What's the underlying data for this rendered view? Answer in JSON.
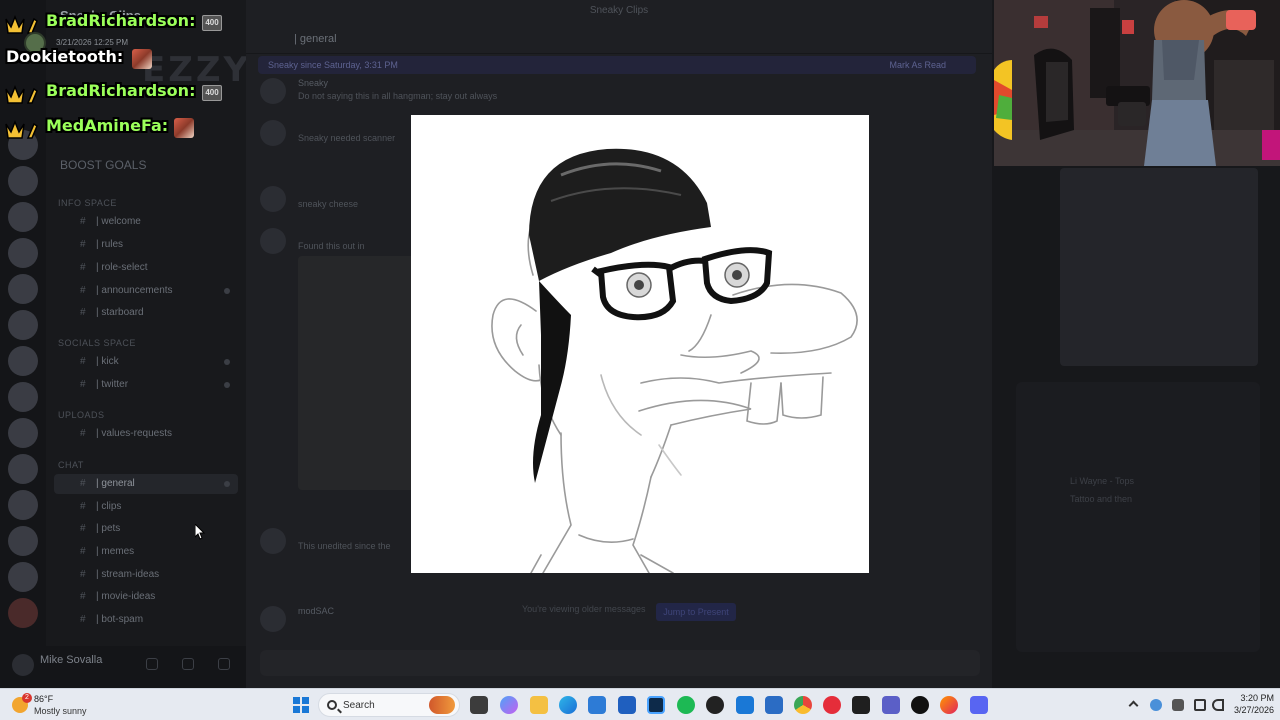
{
  "discord": {
    "window_title": "Sneaky Clips",
    "server_name": "Sneaky Clips",
    "banner_text": "EZZY",
    "channel_title": "| general",
    "boost_line": "BOOST GOALS",
    "categories": [
      {
        "label": "Info space"
      },
      {
        "label": "Socials space"
      },
      {
        "label": "Uploads"
      },
      {
        "label": "Chat"
      }
    ],
    "channels": [
      {
        "label": "| welcome"
      },
      {
        "label": "| rules"
      },
      {
        "label": "| role-select"
      },
      {
        "label": "| announcements"
      },
      {
        "label": "| starboard"
      },
      {
        "label": "| kick"
      },
      {
        "label": "| twitter"
      },
      {
        "label": "| values-requests"
      },
      {
        "label": "| general"
      },
      {
        "label": "| clips"
      },
      {
        "label": "| pets"
      },
      {
        "label": "| memes"
      },
      {
        "label": "| stream-ideas"
      },
      {
        "label": "| movie-ideas"
      },
      {
        "label": "| bot-spam"
      }
    ],
    "user_name": "Mike Sovalla",
    "pinned_text": "Sneaky since Saturday, 3:31 PM",
    "pinned_action": "Mark As Read",
    "messages": [
      {
        "name": "Sneaky",
        "text": "Do not saying this in all hangman; stay out always"
      },
      {
        "name": "",
        "text": "Sneaky needed scanner"
      },
      {
        "name": "",
        "text": "sneaky cheese"
      },
      {
        "name": "",
        "text": "Found this out in"
      },
      {
        "name": "",
        "text": "This unedited since the"
      },
      {
        "name": "modSAC",
        "text": ""
      }
    ],
    "unread_text": "You're viewing older messages",
    "unread_button": "Jump to Present",
    "side_lines": [
      "Li Wayne - Tops",
      "Tattoo and then"
    ]
  },
  "alerts": [
    {
      "name": "BradRichardson:",
      "badge": "400",
      "style": "green"
    },
    {
      "name": "Dookietooth:",
      "badge": "",
      "style": "white"
    },
    {
      "name": "BradRichardson:",
      "badge": "400",
      "style": "green"
    },
    {
      "name": "MedAmineFa:",
      "badge": "",
      "style": "green"
    }
  ],
  "alert_timestamp": "3/21/2026 12:25 PM",
  "taskbar": {
    "weather_badge": "2",
    "temperature": "86°F",
    "condition": "Mostly sunny",
    "search_label": "Search",
    "time": "3:20 PM",
    "date": "3/27/2026",
    "icons": [
      "file-explorer-icon",
      "copilot-icon",
      "folder-icon",
      "edge-icon",
      "store-icon",
      "dropbox-icon",
      "photoshop-icon",
      "spotify-icon",
      "steam-icon",
      "mail-icon",
      "paint-icon",
      "chrome-icon",
      "opera-icon",
      "terminal-icon",
      "calendar-icon",
      "media-icon",
      "firefox-icon",
      "discord-icon"
    ]
  },
  "colors": {
    "alert_green": "#9bff5a",
    "windows_blue": "#1a78d6"
  }
}
